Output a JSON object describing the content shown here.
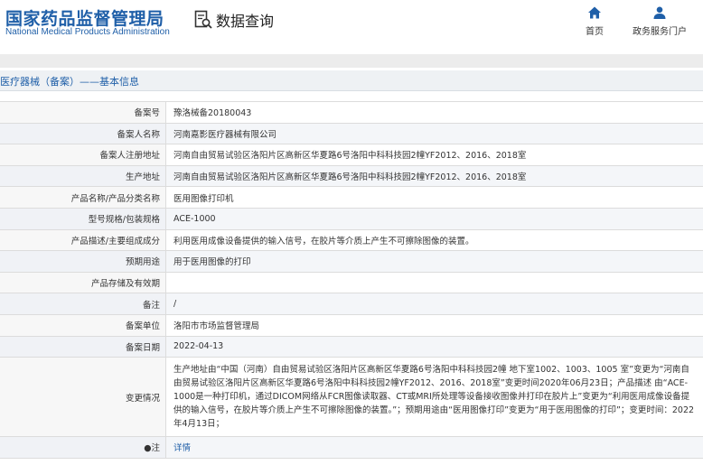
{
  "header": {
    "logo_cn": "国家药品监督管理局",
    "logo_en": "National Medical Products Administration",
    "query_label": "数据查询",
    "nav": [
      {
        "label": "首页",
        "icon": "home-icon"
      },
      {
        "label": "政务服务门户",
        "icon": "user-icon"
      }
    ],
    "brand_color": "#1f5fa8"
  },
  "section": {
    "title": "医疗器械（备案）——基本信息"
  },
  "rows": [
    {
      "label": "备案号",
      "value": "豫洛械备20180043"
    },
    {
      "label": "备案人名称",
      "value": "河南嘉影医疗器械有限公司"
    },
    {
      "label": "备案人注册地址",
      "value": "河南自由贸易试验区洛阳片区高新区华夏路6号洛阳中科科技园2幢YF2012、2016、2018室"
    },
    {
      "label": "生产地址",
      "value": "河南自由贸易试验区洛阳片区高新区华夏路6号洛阳中科科技园2幢YF2012、2016、2018室"
    },
    {
      "label": "产品名称/产品分类名称",
      "value": "医用图像打印机"
    },
    {
      "label": "型号规格/包装规格",
      "value": "ACE-1000"
    },
    {
      "label": "产品描述/主要组成成分",
      "value": "利用医用成像设备提供的输入信号，在胶片等介质上产生不可擦除图像的装置。"
    },
    {
      "label": "预期用途",
      "value": "用于医用图像的打印"
    },
    {
      "label": "产品存储及有效期",
      "value": ""
    },
    {
      "label": "备注",
      "value": "/"
    },
    {
      "label": "备案单位",
      "value": "洛阳市市场监督管理局"
    },
    {
      "label": "备案日期",
      "value": "2022-04-13"
    }
  ],
  "change": {
    "label": "变更情况",
    "value": "生产地址由“中国（河南）自由贸易试验区洛阳片区高新区华夏路6号洛阳中科科技园2幢 地下室1002、1003、1005 室”变更为“河南自由贸易试验区洛阳片区高新区华夏路6号洛阳中科科技园2幢YF2012、2016、2018室”变更时间2020年06月23日；产品描述 由“ACE-1000是一种打印机，通过DICOM网络从FCR图像读取器、CT或MRI所处理等设备接收图像并打印在胶片上”变更为“利用医用成像设备提供的输入信号，在胶片等介质上产生不可擦除图像的装置。”；预期用途由“医用图像打印”变更为“用于医用图像的打印”；变更时间：2022年4月13日；"
  },
  "note": {
    "label": "●注",
    "link": "详情"
  }
}
